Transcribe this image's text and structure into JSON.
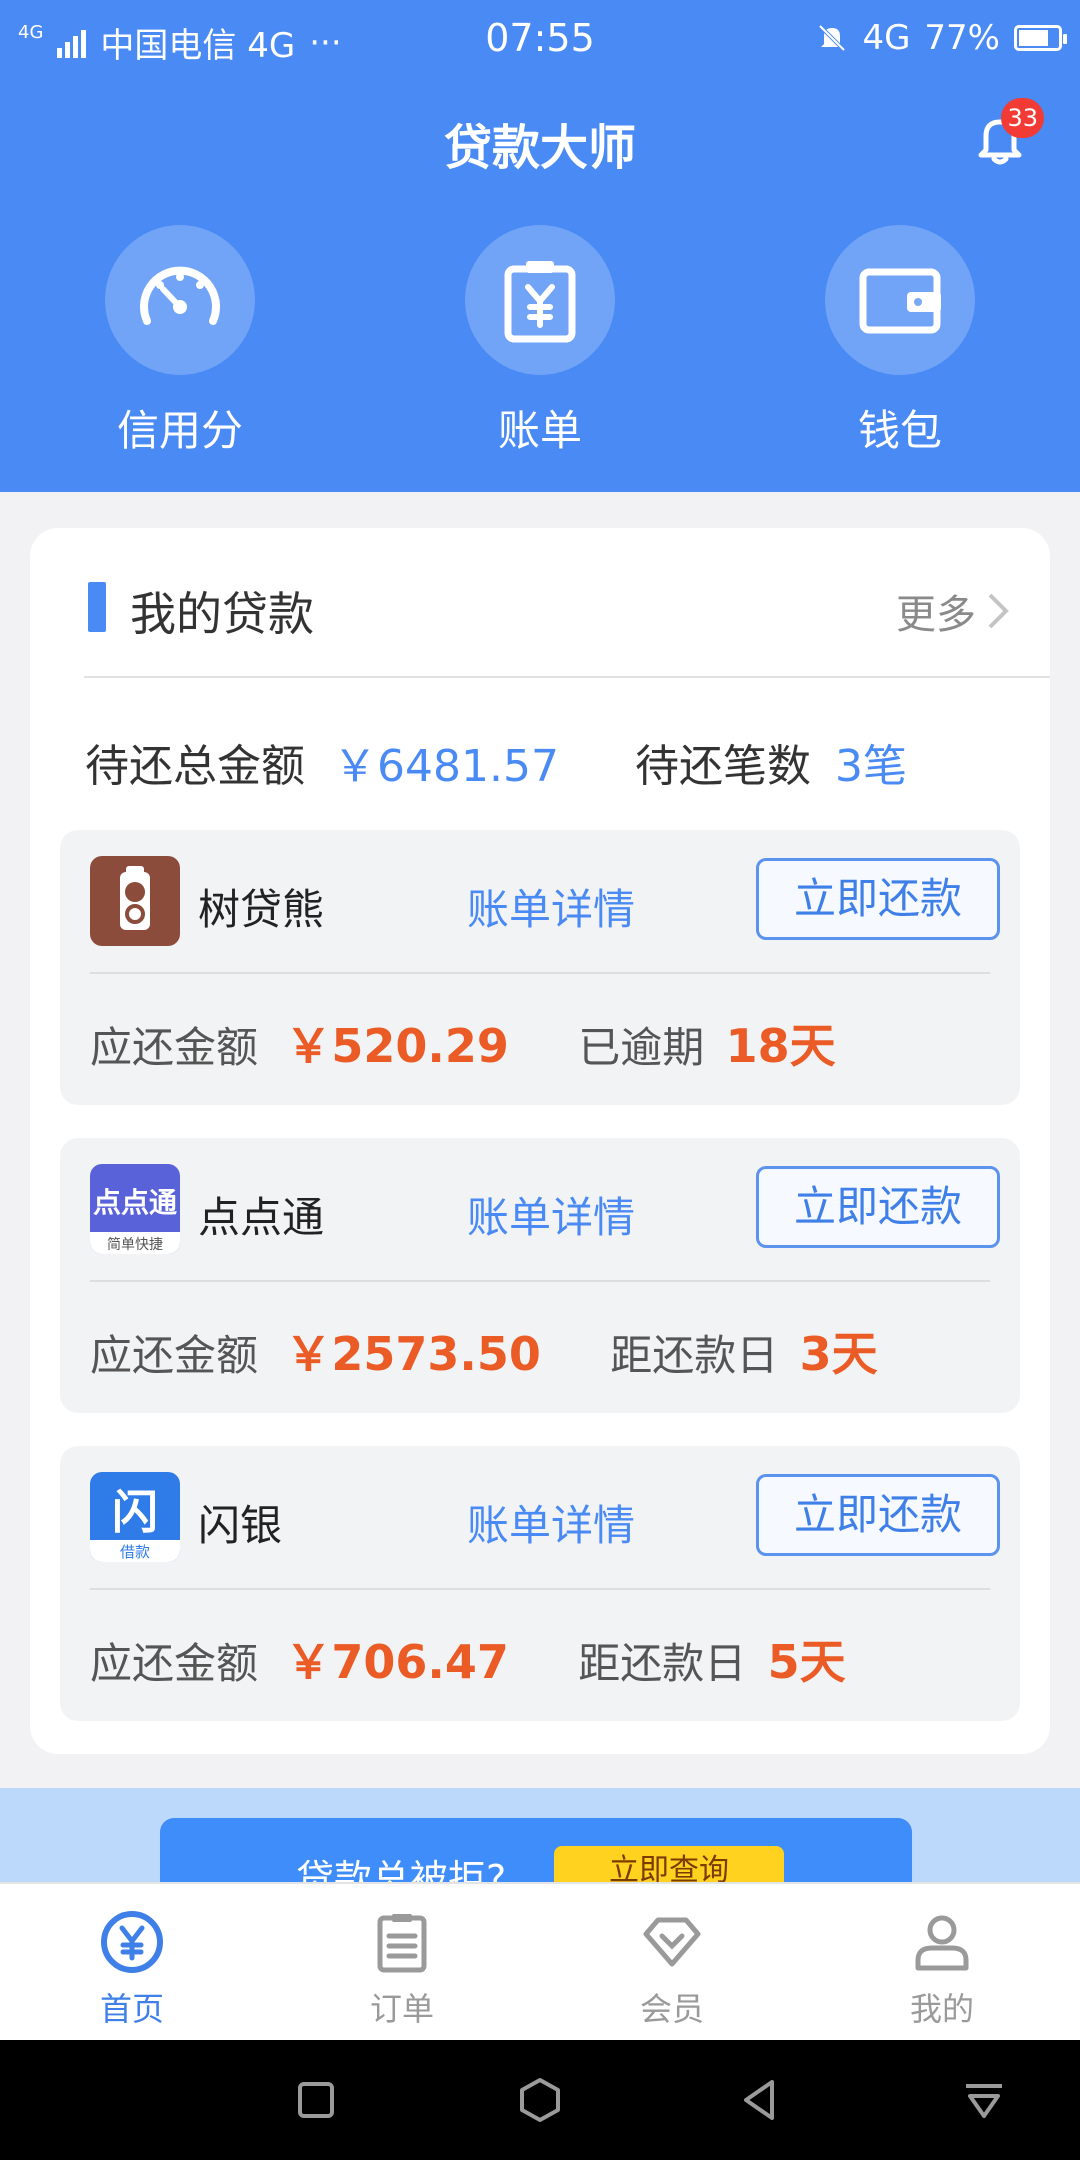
{
  "status_bar": {
    "network_tag": "4G",
    "carrier": "中国电信 4G",
    "dots": "···",
    "time": "07:55",
    "network": "4G",
    "battery": "77%",
    "battery_level": 0.77
  },
  "header": {
    "title": "贷款大师",
    "notification_count": "33",
    "quick_actions": [
      {
        "label": "信用分",
        "icon": "speedometer-icon"
      },
      {
        "label": "账单",
        "icon": "bill-icon"
      },
      {
        "label": "钱包",
        "icon": "wallet-icon"
      }
    ]
  },
  "loans_card": {
    "title": "我的贷款",
    "more_label": "更多",
    "total_label": "待还总金额",
    "total_value": "￥6481.57",
    "count_label": "待还笔数",
    "count_value": "3笔",
    "items": [
      {
        "name": "树贷熊",
        "detail_label": "账单详情",
        "repay_label": "立即还款",
        "amount_label": "应还金额",
        "amount": "￥520.29",
        "status_label": "已逾期",
        "status_value": "18天",
        "logo_color": "#8b4c3c"
      },
      {
        "name": "点点通",
        "detail_label": "账单详情",
        "repay_label": "立即还款",
        "amount_label": "应还金额",
        "amount": "￥2573.50",
        "status_label": "距还款日",
        "status_value": "3天",
        "logo_color": "#5962d9",
        "logo_text": "点点通",
        "logo_sub": "简单快捷"
      },
      {
        "name": "闪银",
        "detail_label": "账单详情",
        "repay_label": "立即还款",
        "amount_label": "应还金额",
        "amount": "￥706.47",
        "status_label": "距还款日",
        "status_value": "5天",
        "logo_color": "#2f7ce8",
        "logo_text": "闪",
        "logo_sub": "借款"
      }
    ]
  },
  "banner": {
    "text": "贷款总被拒?",
    "button": "立即查询"
  },
  "tab_bar": {
    "tabs": [
      {
        "label": "首页",
        "icon": "yuan-circle-icon",
        "active": true
      },
      {
        "label": "订单",
        "icon": "clipboard-icon",
        "active": false
      },
      {
        "label": "会员",
        "icon": "diamond-icon",
        "active": false
      },
      {
        "label": "我的",
        "icon": "person-icon",
        "active": false
      }
    ]
  },
  "colors": {
    "accent": "#4a8af4",
    "amount": "#ea5b26",
    "badge": "#f23b35"
  }
}
